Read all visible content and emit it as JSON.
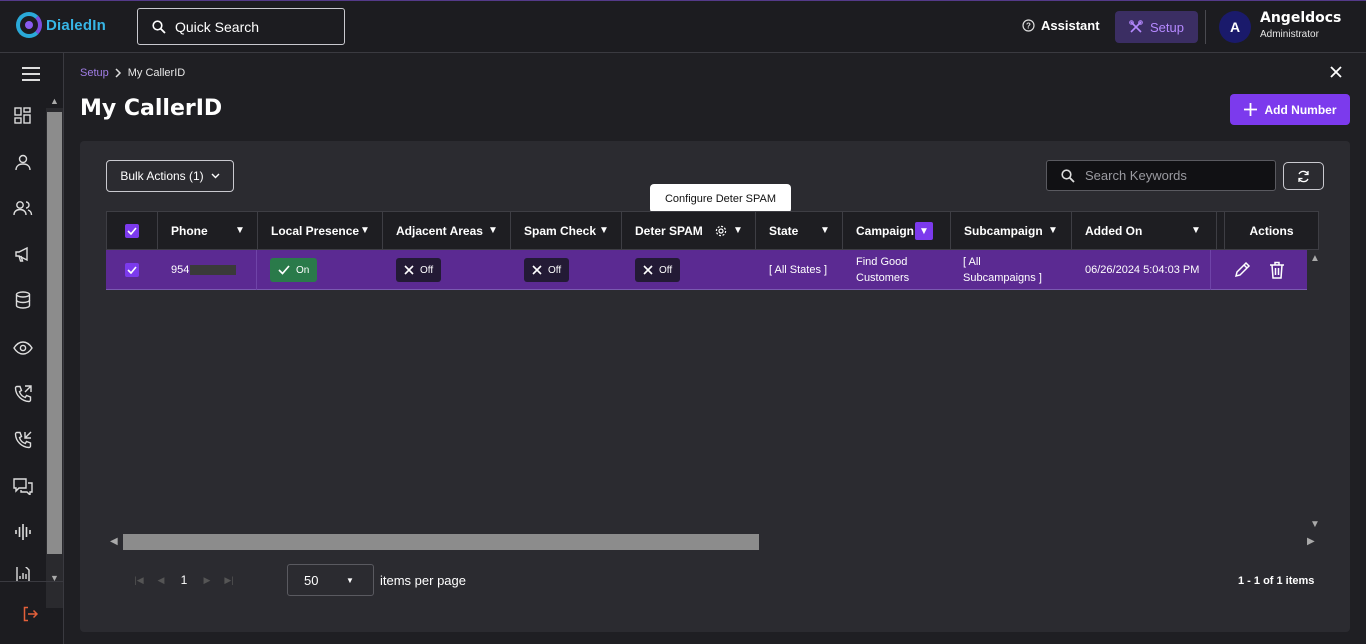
{
  "app": {
    "name": "DialedIn"
  },
  "header": {
    "search_label": "Quick Search",
    "assistant_label": "Assistant",
    "setup_label": "Setup",
    "user": {
      "initial": "A",
      "name": "Angeldocs",
      "role": "Administrator"
    }
  },
  "sidebar": {
    "items": [
      "grid-icon",
      "user-icon",
      "users-icon",
      "megaphone-icon",
      "database-icon",
      "eye-icon",
      "phone-outgoing-icon",
      "phone-incoming-icon",
      "chat-icon",
      "waveform-icon",
      "report-icon"
    ],
    "logout_icon": "logout-icon"
  },
  "breadcrumb": {
    "parent": "Setup",
    "current": "My CallerID"
  },
  "page": {
    "title": "My CallerID",
    "add_button": "Add Number"
  },
  "toolbar": {
    "bulk_actions": "Bulk Actions (1)",
    "search_placeholder": "Search Keywords",
    "tooltip": "Configure Deter SPAM"
  },
  "table": {
    "columns": [
      "Phone",
      "Local Presence",
      "Adjacent Areas",
      "Spam Check",
      "Deter SPAM",
      "State",
      "Campaign",
      "Subcampaign",
      "Added On",
      "Actions"
    ],
    "rows": [
      {
        "selected": true,
        "phone": "954",
        "local_presence": "On",
        "adjacent_areas": "Off",
        "spam_check": "Off",
        "deter_spam": "Off",
        "state": "[ All States ]",
        "campaign_line1": "Find Good",
        "campaign_line2": "Customers",
        "subcampaign_line1": "[ All",
        "subcampaign_line2": "Subcampaigns ]",
        "added_on": "06/26/2024 5:04:03 PM"
      }
    ]
  },
  "pagination": {
    "current_page": "1",
    "per_page": "50",
    "per_page_label": "items per page",
    "info": "1 - 1 of 1 items"
  },
  "colors": {
    "accent": "#7c3aed",
    "row_selected": "#5b2a92",
    "on_toggle": "#2a7a4a"
  }
}
